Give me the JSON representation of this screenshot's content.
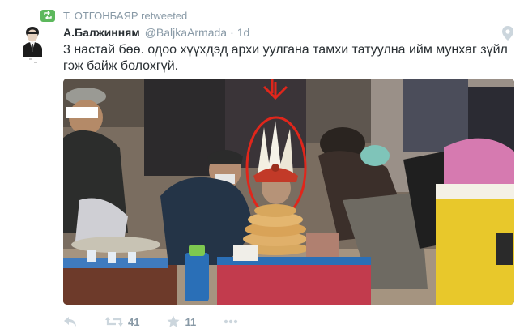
{
  "retweet": {
    "text": "Т. ОТГОНБАЯР retweeted",
    "icon": "retweet-icon"
  },
  "tweet": {
    "author_name": "А.Балжинням",
    "handle": "@BaljkaArmada",
    "separator": "·",
    "time": "1d",
    "text": "3 настай бөө. одоо хүүхдэд архи уулгана тамхи татуулна ийм мунхаг зүйл гэж байж болохгүй."
  },
  "media": {
    "icon": "photo-image"
  },
  "actions": {
    "reply_icon": "reply-icon",
    "retweet_icon": "retweet-icon",
    "retweet_count": "41",
    "favorite_icon": "star-icon",
    "favorite_count": "11",
    "more_icon": "more-icon"
  },
  "colors": {
    "text": "#292f33",
    "muted": "#8899a6",
    "retweet_green": "#5cb85c",
    "highlight_red": "#e0261b"
  }
}
